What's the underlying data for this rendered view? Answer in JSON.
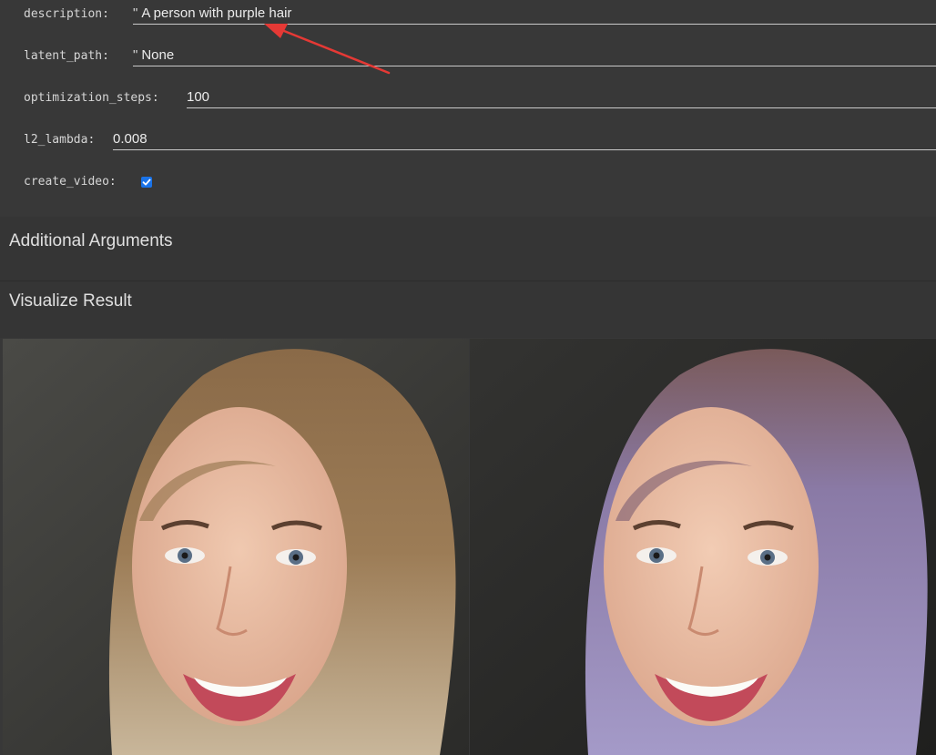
{
  "form": {
    "description": {
      "label": "description:",
      "quote": "\"",
      "value": "A person with purple hair"
    },
    "latent_path": {
      "label": "latent_path:",
      "quote": "\"",
      "value": "None"
    },
    "optimization_steps": {
      "label": "optimization_steps:",
      "value": "100"
    },
    "l2_lambda": {
      "label": "l2_lambda:",
      "value": "0.008"
    },
    "create_video": {
      "label": "create_video:",
      "checked": true
    }
  },
  "sections": {
    "additional_arguments": "Additional Arguments",
    "visualize_result": "Visualize Result"
  },
  "images": {
    "original": "original-face-image",
    "edited": "edited-face-image-purple-hair"
  },
  "colors": {
    "background": "#383838",
    "checkbox": "#1a73e8",
    "annotation_arrow": "#e53935"
  }
}
